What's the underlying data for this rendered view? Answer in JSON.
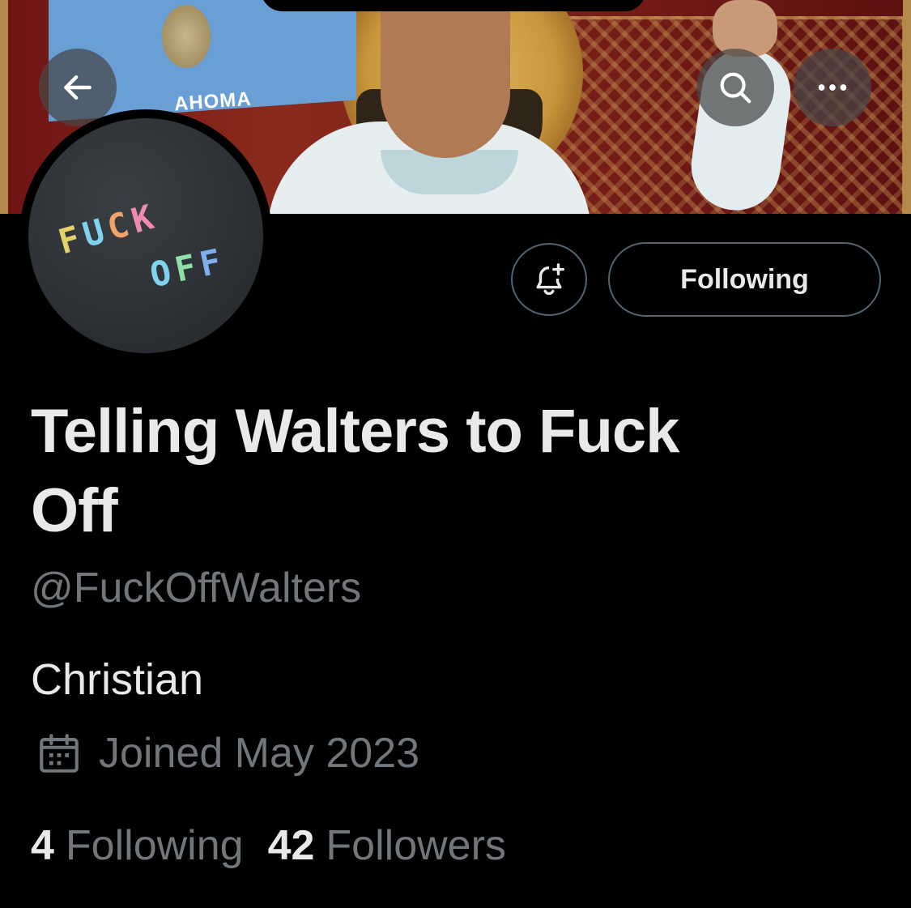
{
  "banner": {
    "flag_text": "AHOMA"
  },
  "header_actions": {
    "back_icon": "arrow-left-icon",
    "search_icon": "search-icon",
    "more_icon": "more-horizontal-icon"
  },
  "avatar": {
    "line1": [
      "F",
      "U",
      "C",
      "K"
    ],
    "line2": [
      "O",
      "F",
      "F"
    ]
  },
  "actions": {
    "notify_icon": "bell-plus-icon",
    "follow_label": "Following"
  },
  "profile": {
    "display_name": "Telling Walters to Fuck Off",
    "handle": "@FuckOffWalters",
    "bio": "Christian",
    "joined_icon": "calendar-icon",
    "joined": "Joined May 2023",
    "following_count": "4",
    "following_label": "Following",
    "followers_count": "42",
    "followers_label": "Followers"
  },
  "colors": {
    "background": "#000000",
    "primary_text": "#e7e9ea",
    "secondary_text": "#71767b",
    "border": "#536471"
  }
}
